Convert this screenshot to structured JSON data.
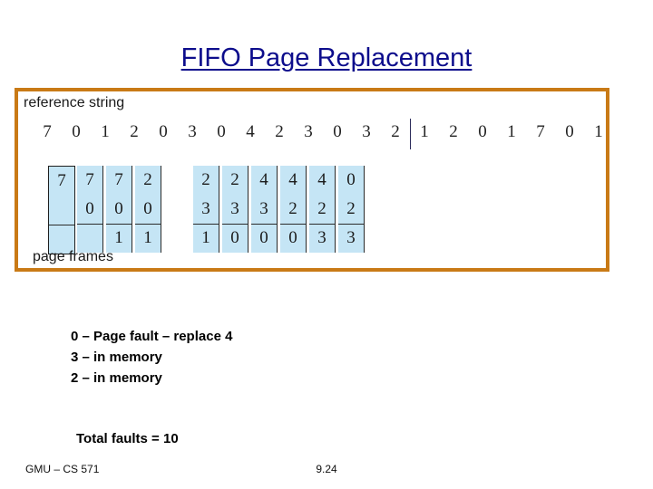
{
  "slide": {
    "title": "FIFO Page Replacement",
    "title_color": "#0d0d8c",
    "border_color": "#c97a16",
    "cell_highlight_color": "#c5e5f5"
  },
  "figure": {
    "reference_string_label": "reference string",
    "page_frames_label": "page frames",
    "reference_string": [
      "7",
      "0",
      "1",
      "2",
      "0",
      "3",
      "0",
      "4",
      "2",
      "3",
      "0",
      "3",
      "2",
      "1",
      "2",
      "0",
      "1",
      "7",
      "0",
      "1"
    ],
    "divider_after_index": 12,
    "frames": {
      "rows": 3,
      "columns": [
        {
          "values": [
            "7",
            "",
            ""
          ],
          "boxed": true
        },
        {
          "values": [
            "7",
            "0",
            ""
          ],
          "boxed": false
        },
        {
          "values": [
            "7",
            "0",
            "1"
          ],
          "boxed": false
        },
        {
          "values": [
            "2",
            "0",
            "1"
          ],
          "boxed": false
        },
        {
          "values": [
            "",
            "",
            ""
          ],
          "boxed": false
        },
        {
          "values": [
            "2",
            "3",
            "1"
          ],
          "boxed": false
        },
        {
          "values": [
            "2",
            "3",
            "0"
          ],
          "boxed": false
        },
        {
          "values": [
            "4",
            "3",
            "0"
          ],
          "boxed": false
        },
        {
          "values": [
            "4",
            "2",
            "0"
          ],
          "boxed": false
        },
        {
          "values": [
            "4",
            "2",
            "3"
          ],
          "boxed": false
        },
        {
          "values": [
            "0",
            "2",
            "3"
          ],
          "boxed": false
        }
      ]
    }
  },
  "notes": {
    "lines": [
      "0 – Page fault – replace 4",
      "3 – in memory",
      "2 – in memory"
    ],
    "total_faults": "Total faults = 10"
  },
  "footer": {
    "course": "GMU – CS 571",
    "page_number": "9.24"
  }
}
